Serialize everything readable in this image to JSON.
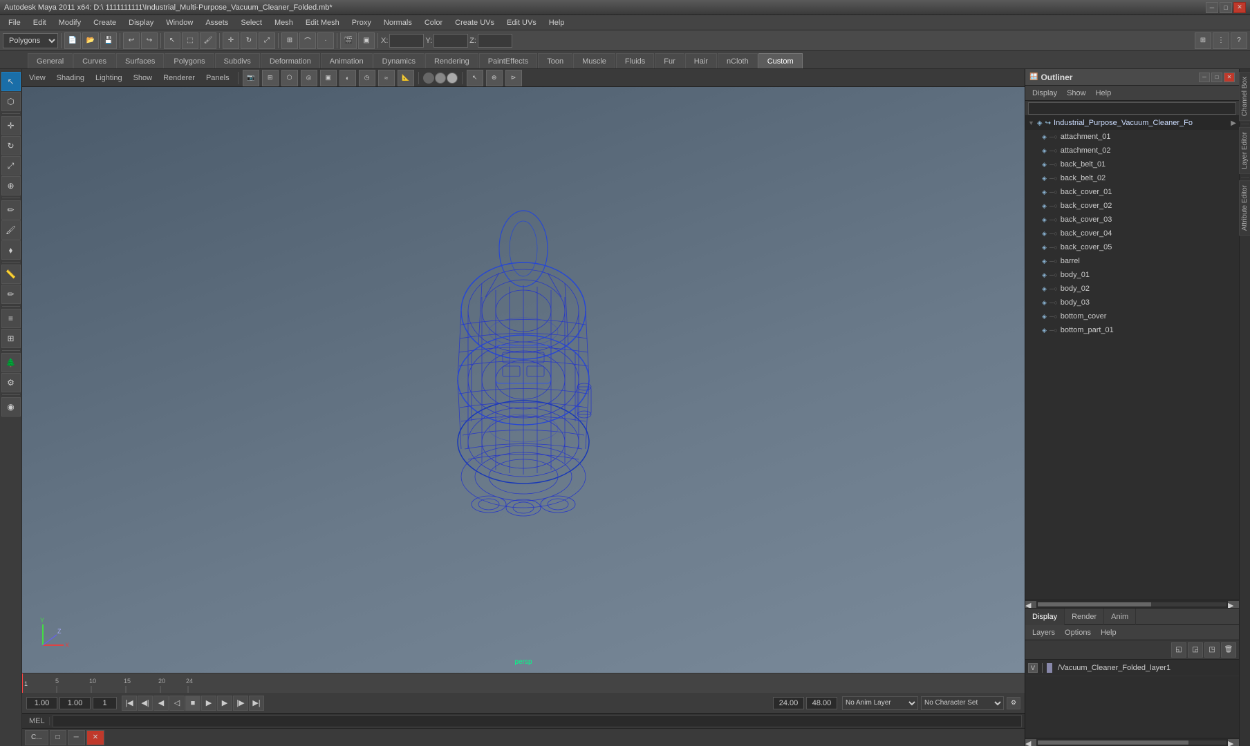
{
  "titlebar": {
    "title": "Autodesk Maya 2011 x64: D:\\  1111111111\\Industrial_Multi-Purpose_Vacuum_Cleaner_Folded.mb*",
    "minimize": "─",
    "maximize": "□",
    "close": "✕"
  },
  "menubar": {
    "items": [
      "File",
      "Edit",
      "Modify",
      "Create",
      "Display",
      "Window",
      "Assets",
      "Select",
      "Mesh",
      "Edit Mesh",
      "Proxy",
      "Normals",
      "Color",
      "Create UVs",
      "Edit UVs",
      "Help"
    ]
  },
  "toolbar": {
    "mode": "Polygons",
    "x_label": "X:",
    "y_label": "Y:",
    "z_label": "Z:"
  },
  "tabs": {
    "items": [
      "General",
      "Curves",
      "Surfaces",
      "Polygons",
      "Subdivs",
      "Deformation",
      "Animation",
      "Dynamics",
      "Rendering",
      "PaintEffects",
      "Toon",
      "Muscle",
      "Fluids",
      "Fur",
      "Hair",
      "nCloth",
      "Custom"
    ],
    "active": "Custom"
  },
  "viewport": {
    "menus": [
      "View",
      "Shading",
      "Lighting",
      "Show",
      "Renderer",
      "Panels"
    ],
    "center_label": "persp"
  },
  "outliner": {
    "title": "Outliner",
    "menus": [
      "Display",
      "Show",
      "Help"
    ],
    "search_placeholder": "",
    "items": [
      {
        "name": "Industrial_Purpose_Vacuum_Cleaner_Fo",
        "type": "root"
      },
      {
        "name": "attachment_01",
        "indent": 1
      },
      {
        "name": "attachment_02",
        "indent": 1
      },
      {
        "name": "back_belt_01",
        "indent": 1
      },
      {
        "name": "back_belt_02",
        "indent": 1
      },
      {
        "name": "back_cover_01",
        "indent": 1
      },
      {
        "name": "back_cover_02",
        "indent": 1
      },
      {
        "name": "back_cover_03",
        "indent": 1
      },
      {
        "name": "back_cover_04",
        "indent": 1
      },
      {
        "name": "back_cover_05",
        "indent": 1
      },
      {
        "name": "barrel",
        "indent": 1
      },
      {
        "name": "body_01",
        "indent": 1
      },
      {
        "name": "body_02",
        "indent": 1
      },
      {
        "name": "body_03",
        "indent": 1
      },
      {
        "name": "bottom_cover",
        "indent": 1
      },
      {
        "name": "bottom_part_01",
        "indent": 1
      }
    ]
  },
  "layer_editor": {
    "tabs": [
      "Display",
      "Render",
      "Anim"
    ],
    "active_tab": "Display",
    "menus": [
      "Layers",
      "Options",
      "Help"
    ],
    "layer": {
      "v_label": "V",
      "name": "Vacuum_Cleaner_Folded_layer1"
    }
  },
  "channel_sidebar": {
    "channel_box": "Channel Box",
    "layer_editor": "Layer Editor",
    "attribute_editor": "Attribute Editor"
  },
  "timeline": {
    "ticks": [
      "1",
      "",
      "",
      "",
      "5",
      "",
      "",
      "",
      "",
      "10",
      "",
      "",
      "",
      "",
      "15",
      "",
      "",
      "",
      "",
      "20",
      "",
      "",
      "",
      "",
      "24"
    ],
    "start": "1",
    "end": "24"
  },
  "anim_controls": {
    "start_frame": "1.00",
    "end_frame": "1.00",
    "current_frame": "1",
    "range_start": "1",
    "range_end": "24",
    "range_end2": "24.00",
    "range_end3": "48.00",
    "anim_layer": "No Anim Layer",
    "character_set": "No Character Set"
  },
  "status_bar": {
    "mel_label": "MEL",
    "mel_input": "",
    "result_label": ""
  },
  "mini_windows": {
    "items": [
      "C...",
      "□",
      "─",
      "✕"
    ]
  },
  "icons": {
    "transform": "↖",
    "move": "✛",
    "rotate": "↻",
    "scale": "⤢",
    "arrow": "→",
    "mesh": "⬡",
    "layers": "≡",
    "camera": "📷",
    "play": "▶",
    "prev": "◀",
    "next": "▶",
    "step_back": "⏮",
    "step_fwd": "⏭",
    "first": "|◀",
    "last": "▶|"
  }
}
